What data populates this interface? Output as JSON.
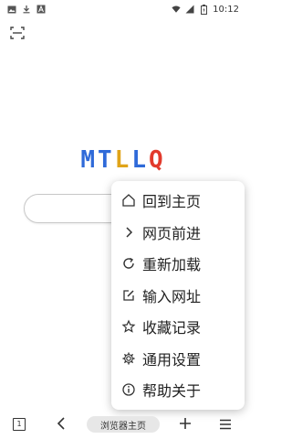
{
  "status_bar": {
    "time": "10:12",
    "left_icons": [
      "image-icon",
      "download-icon",
      "font-icon"
    ],
    "right_icons": [
      "wifi-icon",
      "signal-icon",
      "battery-icon"
    ]
  },
  "scan_button": {
    "icon": "scan-icon"
  },
  "logo": {
    "letters": [
      {
        "char": "M",
        "color": "#2f6ad9"
      },
      {
        "char": "T",
        "color": "#2f6ad9"
      },
      {
        "char": "L",
        "color": "#e0a419"
      },
      {
        "char": "L",
        "color": "#2f6ad9"
      },
      {
        "char": "Q",
        "color": "#e23a2c"
      }
    ]
  },
  "search": {
    "placeholder": ""
  },
  "menu": {
    "items": [
      {
        "label": "回到主页",
        "icon": "home-icon"
      },
      {
        "label": "网页前进",
        "icon": "chevron-right-icon"
      },
      {
        "label": "重新加载",
        "icon": "reload-icon"
      },
      {
        "label": "输入网址",
        "icon": "edit-icon"
      },
      {
        "label": "收藏记录",
        "icon": "star-icon"
      },
      {
        "label": "通用设置",
        "icon": "gear-icon"
      },
      {
        "label": "帮助关于",
        "icon": "info-icon"
      }
    ]
  },
  "toolbar": {
    "tabs_count": "1",
    "home_label": "浏览器主页",
    "icons": [
      "tabs-icon",
      "back-icon",
      "add-icon",
      "menu-icon"
    ]
  },
  "colors": {
    "logo_blue": "#2f6ad9",
    "logo_yellow": "#e0a419",
    "logo_red": "#e23a2c"
  }
}
